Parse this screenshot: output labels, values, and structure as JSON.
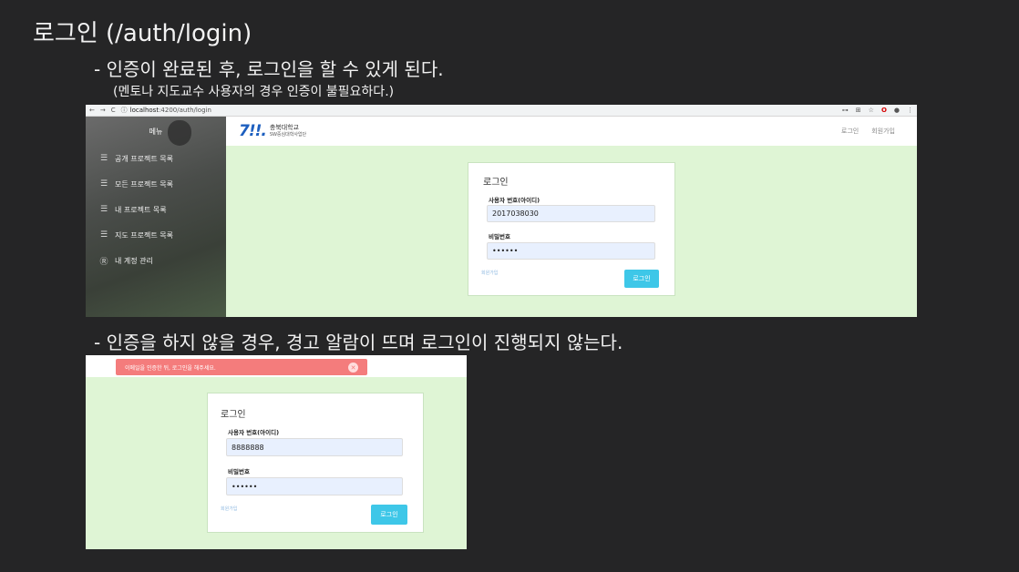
{
  "slide": {
    "title": "로그인 (/auth/login)",
    "bullet1": "- 인증이 완료된 후, 로그인을 할 수 있게 된다.",
    "note": "(멘토나 지도교수 사용자의 경우 인증이 불필요하다.)",
    "bullet2": "- 인증을 하지 않을 경우, 경고 알람이 뜨며 로그인이 진행되지 않는다."
  },
  "browser": {
    "back": "←",
    "forward": "→",
    "reload": "C",
    "info": "ⓘ",
    "url_host": "localhost",
    "url_path": ":4200/auth/login",
    "ext_key": "⊶",
    "ext_translate": "⊞",
    "ext_star": "☆",
    "ext_opera": "O",
    "ext_profile": "●",
    "ext_menu": "⋮"
  },
  "sidebar": {
    "header": "메뉴",
    "items": [
      {
        "icon": "list-icon",
        "glyph": "☰",
        "label": "공개 프로젝트 목록"
      },
      {
        "icon": "list-icon",
        "glyph": "☰",
        "label": "모든 프로젝트 목록"
      },
      {
        "icon": "list-icon",
        "glyph": "☰",
        "label": "내 프로젝트 목록"
      },
      {
        "icon": "list-icon",
        "glyph": "☰",
        "label": "지도 프로젝트 목록"
      },
      {
        "icon": "user-circle-icon",
        "glyph": "Ⓡ",
        "label": "내 계정 관리"
      }
    ]
  },
  "header": {
    "logo_mark_1": "7",
    "logo_mark_2": "!!.",
    "logo_line1": "충북대학교",
    "logo_line2": "SW중심대학사업단",
    "nav_login": "로그인",
    "nav_signup": "회원가입"
  },
  "login1": {
    "title": "로그인",
    "id_label": "사용자 번호(아이디)",
    "id_value": "2017038030",
    "pw_label": "비밀번호",
    "pw_value": "••••••",
    "signup_link": "회원가입",
    "submit": "로그인"
  },
  "alert": {
    "message": "이메일을 인증한 뒤, 로그인을 해주세요.",
    "close": "✕"
  },
  "login2": {
    "title": "로그인",
    "id_label": "사용자 번호(아이디)",
    "id_value": "8888888",
    "pw_label": "비밀번호",
    "pw_value": "••••••",
    "signup_link": "회원가입",
    "submit": "로그인"
  }
}
